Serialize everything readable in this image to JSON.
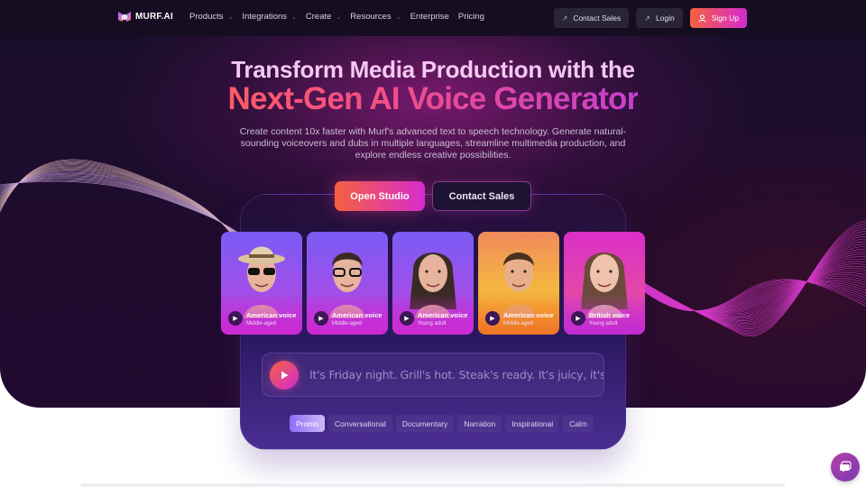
{
  "brand": {
    "name": "MURF.AI"
  },
  "nav": {
    "links": [
      {
        "label": "Products",
        "dropdown": true
      },
      {
        "label": "Integrations",
        "dropdown": true
      },
      {
        "label": "Create",
        "dropdown": true
      },
      {
        "label": "Resources",
        "dropdown": true
      },
      {
        "label": "Enterprise",
        "dropdown": false
      },
      {
        "label": "Pricing",
        "dropdown": false
      }
    ],
    "contact_sales": "Contact Sales",
    "login": "Login",
    "signup": "Sign Up"
  },
  "hero": {
    "title_line1": "Transform Media Production with the",
    "title_line2": "Next-Gen AI Voice Generator",
    "subtitle": "Create content 10x faster with Murf's advanced text to speech technology. Generate natural-sounding voiceovers and dubs in multiple languages, streamline multimedia production, and explore endless creative possibilities.",
    "primary_cta": "Open Studio",
    "secondary_cta": "Contact Sales"
  },
  "voices": [
    {
      "name": "American voice",
      "age": "Middle-aged",
      "theme": "violet"
    },
    {
      "name": "American voice",
      "age": "Middle-aged",
      "theme": "violet"
    },
    {
      "name": "American voice",
      "age": "Young adult",
      "theme": "violet"
    },
    {
      "name": "American voice",
      "age": "Middle-aged",
      "theme": "orange"
    },
    {
      "name": "British voice",
      "age": "Young adult",
      "theme": "pink"
    }
  ],
  "sample": {
    "text": "It's Friday night. Grill's hot. Steak's ready. It's juicy, it's ter"
  },
  "styles": {
    "active": "Promo",
    "items": [
      "Promo",
      "Conversational",
      "Documentary",
      "Narration",
      "Inspirational",
      "Calm"
    ]
  },
  "colors": {
    "accent_start": "#f5613f",
    "accent_end": "#d52ad0",
    "nav_bg": "#150d22",
    "hero_bg": "#1e0c2e"
  }
}
